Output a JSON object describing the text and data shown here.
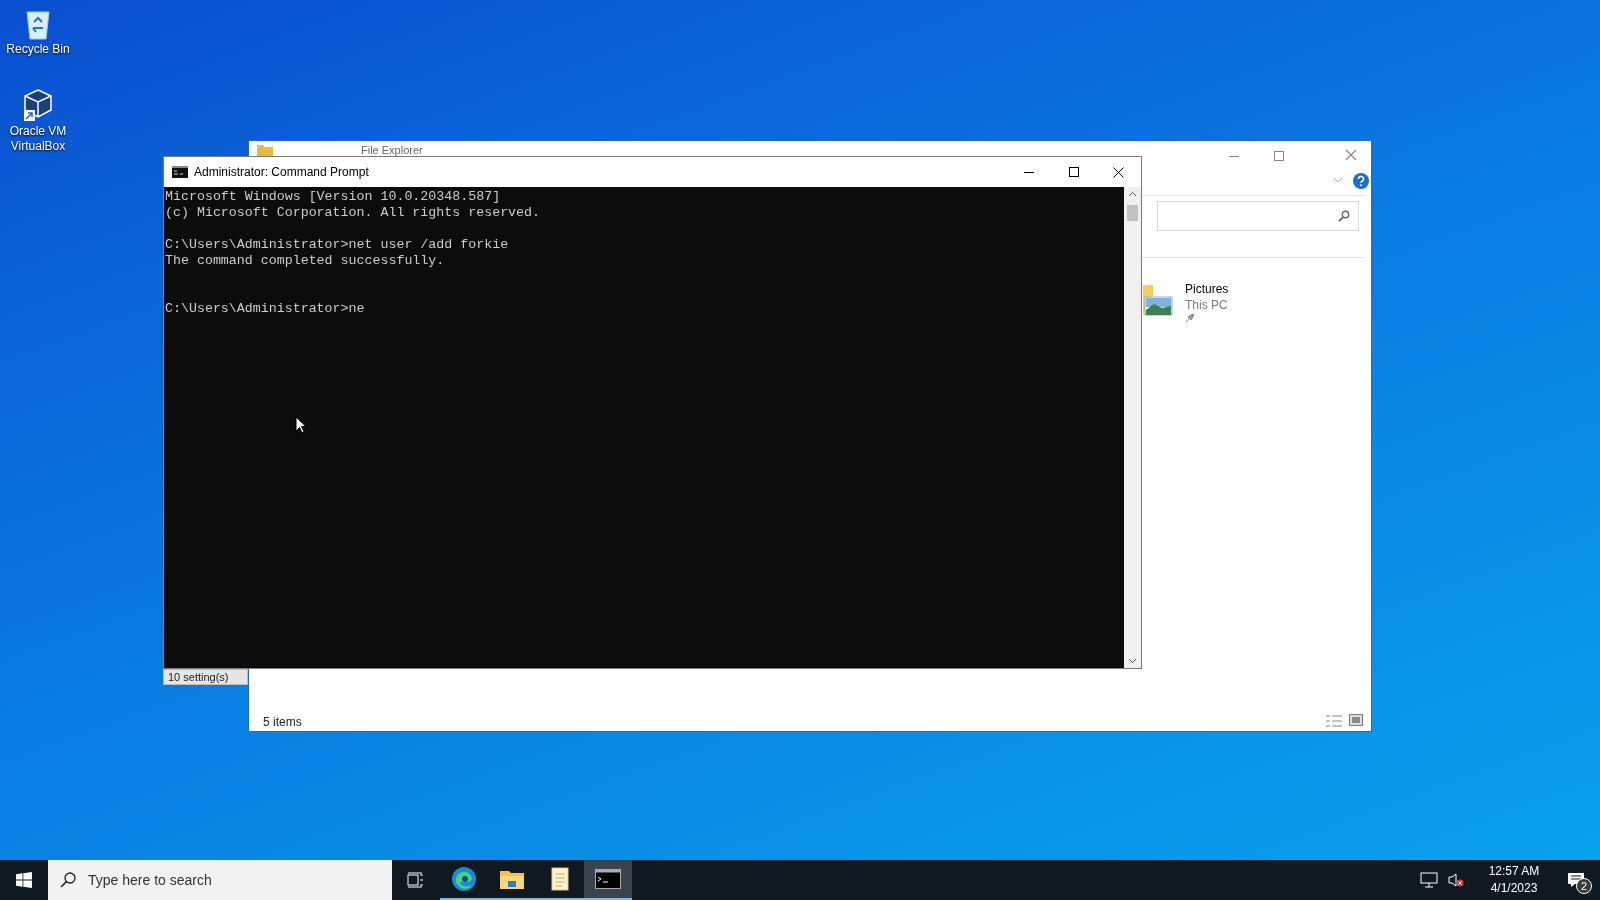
{
  "desktop_icons": [
    {
      "kind": "recycle",
      "label": "Recycle Bin"
    },
    {
      "kind": "virtualbox",
      "label": "Oracle VM VirtualBox"
    }
  ],
  "explorer": {
    "title": "File Explorer",
    "item": {
      "name": "Pictures",
      "location": "This PC"
    },
    "status": "5 items"
  },
  "background_window": {
    "status": "10 setting(s)"
  },
  "cmd": {
    "title": "Administrator: Command Prompt",
    "output": "Microsoft Windows [Version 10.0.20348.587]\n(c) Microsoft Corporation. All rights reserved.\n\nC:\\Users\\Administrator>net user /add forkie\nThe command completed successfully.\n\n\nC:\\Users\\Administrator>ne"
  },
  "taskbar": {
    "search_placeholder": "Type here to search",
    "apps": [
      {
        "kind": "edge",
        "selected": false
      },
      {
        "kind": "folder",
        "selected": false
      },
      {
        "kind": "notepad",
        "selected": false
      },
      {
        "kind": "terminal",
        "selected": true
      }
    ],
    "time": "12:57 AM",
    "date": "4/1/2023",
    "notifications": "2"
  }
}
